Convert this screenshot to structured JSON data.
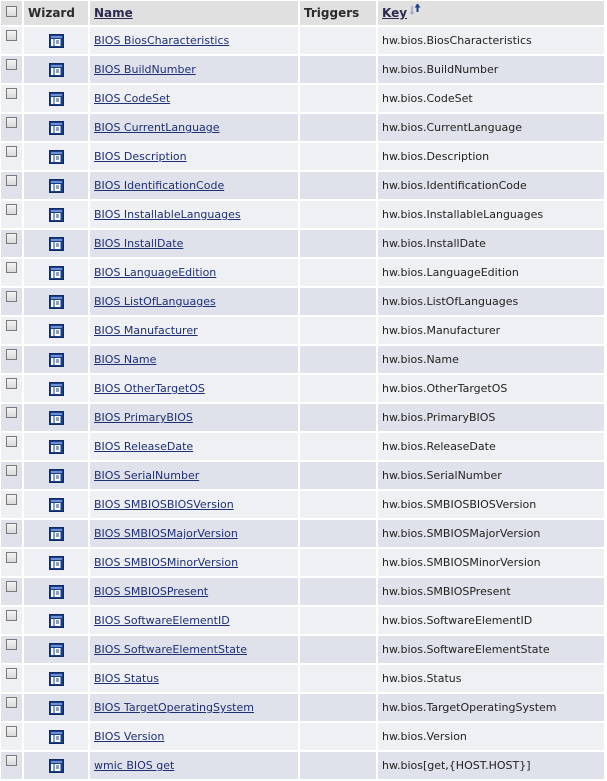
{
  "header": {
    "wizard_label": "Wizard",
    "name_label": "Name",
    "triggers_label": "Triggers",
    "key_label": "Key"
  },
  "colors": {
    "row_odd": "#eef0f4",
    "row_even": "#dfe2ea",
    "header_bg": "#e0e0e0",
    "link": "#1f2f74",
    "wizard_icon": "#1a3f8a"
  },
  "icons": {
    "wizard": "wizard-icon",
    "sort": "sort-ascending-icon"
  },
  "rows": [
    {
      "name": "BIOS BiosCharacteristics",
      "triggers": "",
      "key": "hw.bios.BiosCharacteristics"
    },
    {
      "name": "BIOS BuildNumber",
      "triggers": "",
      "key": "hw.bios.BuildNumber"
    },
    {
      "name": "BIOS CodeSet",
      "triggers": "",
      "key": "hw.bios.CodeSet"
    },
    {
      "name": "BIOS CurrentLanguage",
      "triggers": "",
      "key": "hw.bios.CurrentLanguage"
    },
    {
      "name": "BIOS Description",
      "triggers": "",
      "key": "hw.bios.Description"
    },
    {
      "name": "BIOS IdentificationCode",
      "triggers": "",
      "key": "hw.bios.IdentificationCode"
    },
    {
      "name": "BIOS InstallableLanguages",
      "triggers": "",
      "key": "hw.bios.InstallableLanguages"
    },
    {
      "name": "BIOS InstallDate",
      "triggers": "",
      "key": "hw.bios.InstallDate"
    },
    {
      "name": "BIOS LanguageEdition",
      "triggers": "",
      "key": "hw.bios.LanguageEdition"
    },
    {
      "name": "BIOS ListOfLanguages",
      "triggers": "",
      "key": "hw.bios.ListOfLanguages"
    },
    {
      "name": "BIOS Manufacturer",
      "triggers": "",
      "key": "hw.bios.Manufacturer"
    },
    {
      "name": "BIOS Name",
      "triggers": "",
      "key": "hw.bios.Name"
    },
    {
      "name": "BIOS OtherTargetOS",
      "triggers": "",
      "key": "hw.bios.OtherTargetOS"
    },
    {
      "name": "BIOS PrimaryBIOS",
      "triggers": "",
      "key": "hw.bios.PrimaryBIOS"
    },
    {
      "name": "BIOS ReleaseDate",
      "triggers": "",
      "key": "hw.bios.ReleaseDate"
    },
    {
      "name": "BIOS SerialNumber",
      "triggers": "",
      "key": "hw.bios.SerialNumber"
    },
    {
      "name": "BIOS SMBIOSBIOSVersion",
      "triggers": "",
      "key": "hw.bios.SMBIOSBIOSVersion"
    },
    {
      "name": "BIOS SMBIOSMajorVersion",
      "triggers": "",
      "key": "hw.bios.SMBIOSMajorVersion"
    },
    {
      "name": "BIOS SMBIOSMinorVersion",
      "triggers": "",
      "key": "hw.bios.SMBIOSMinorVersion"
    },
    {
      "name": "BIOS SMBIOSPresent",
      "triggers": "",
      "key": "hw.bios.SMBIOSPresent"
    },
    {
      "name": "BIOS SoftwareElementID",
      "triggers": "",
      "key": "hw.bios.SoftwareElementID"
    },
    {
      "name": "BIOS SoftwareElementState",
      "triggers": "",
      "key": "hw.bios.SoftwareElementState"
    },
    {
      "name": "BIOS Status",
      "triggers": "",
      "key": "hw.bios.Status"
    },
    {
      "name": "BIOS TargetOperatingSystem",
      "triggers": "",
      "key": "hw.bios.TargetOperatingSystem"
    },
    {
      "name": "BIOS Version",
      "triggers": "",
      "key": "hw.bios.Version"
    },
    {
      "name": "wmic BIOS get",
      "triggers": "",
      "key": "hw.bios[get,{HOST.HOST}]"
    }
  ]
}
